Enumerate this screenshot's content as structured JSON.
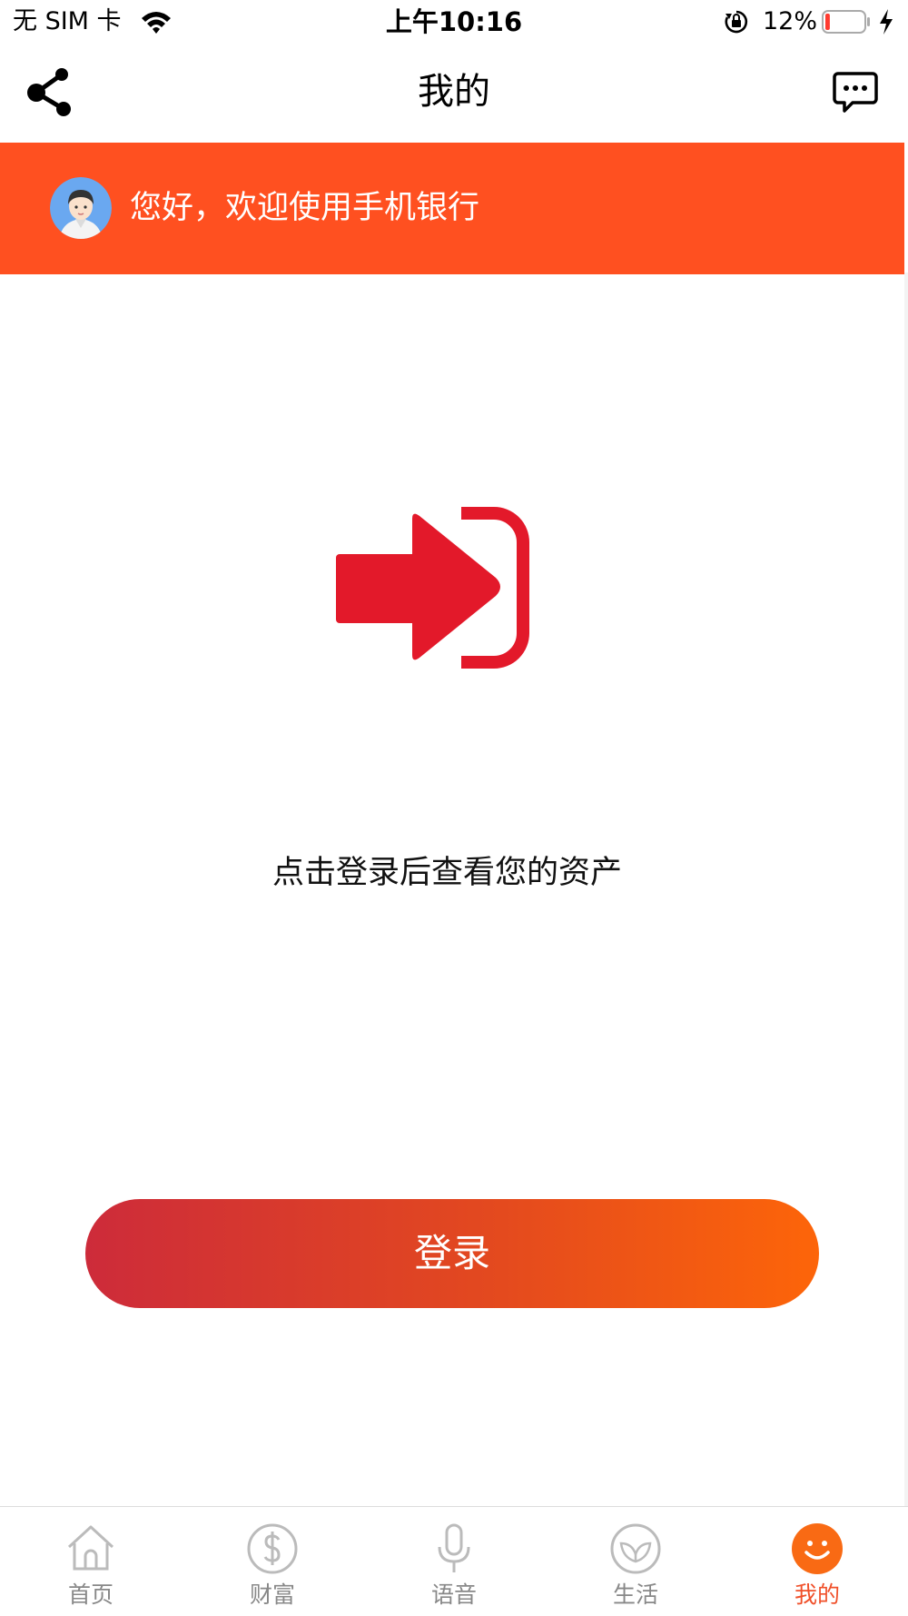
{
  "status_bar": {
    "carrier": "无 SIM 卡",
    "time": "上午10:16",
    "battery_percent": "12%",
    "battery_level": 0.12,
    "icons": [
      "wifi-icon",
      "rotation-lock-icon",
      "battery-icon",
      "charging-icon"
    ]
  },
  "nav": {
    "title": "我的",
    "left_icon": "share-icon",
    "right_icon": "message-icon"
  },
  "banner": {
    "greeting": "您好，欢迎使用手机银行",
    "background": "#ff5020"
  },
  "main": {
    "illustration": "login-arrow-icon",
    "prompt": "点击登录后查看您的资产",
    "login_button": "登录",
    "accent": "#e3192a"
  },
  "tabs": [
    {
      "label": "首页",
      "icon": "home-icon",
      "active": false
    },
    {
      "label": "财富",
      "icon": "dollar-icon",
      "active": false
    },
    {
      "label": "语音",
      "icon": "microphone-icon",
      "active": false
    },
    {
      "label": "生活",
      "icon": "leaf-icon",
      "active": false
    },
    {
      "label": "我的",
      "icon": "smiley-icon",
      "active": true
    }
  ],
  "colors": {
    "tab_active": "#f0502a",
    "tab_inactive": "#888888",
    "button_gradient": [
      "#cd2b3a",
      "#fd6509"
    ]
  }
}
